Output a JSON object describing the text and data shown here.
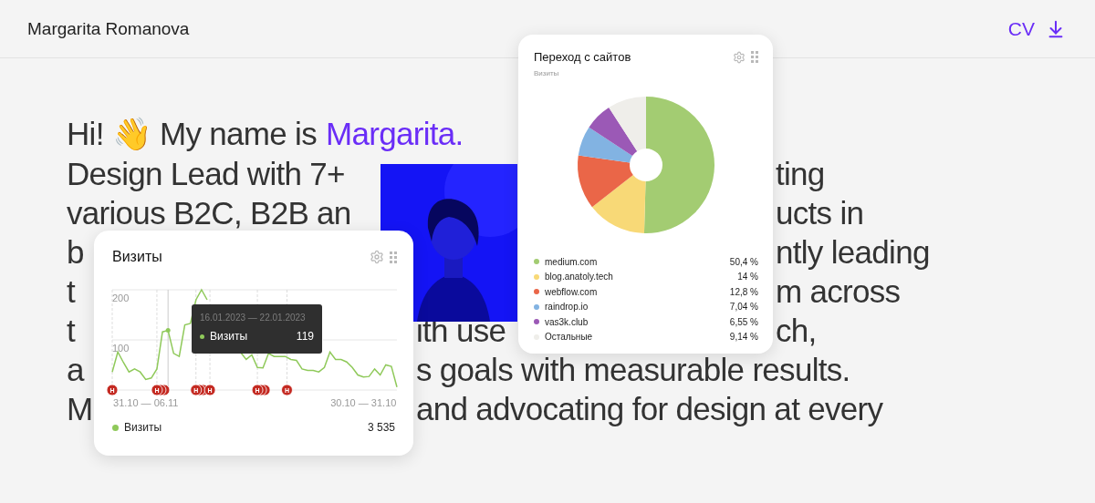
{
  "header": {
    "name": "Margarita Romanova",
    "cv_label": "CV"
  },
  "hero": {
    "lines": [
      {
        "segments": [
          {
            "text": "Hi! 👋 My name is",
            "kind": "left",
            "accent": false
          },
          {
            "text": "Margarita.",
            "kind": "left",
            "accent": true
          }
        ]
      },
      {
        "segments": [
          {
            "text": "Design Lead with 7+",
            "kind": "left",
            "accent": false
          },
          {
            "text": "ting",
            "kind": "right",
            "accent": false
          }
        ]
      },
      {
        "segments": [
          {
            "text": "various B2C, B2B an",
            "kind": "left",
            "accent": false
          },
          {
            "text": "ucts in",
            "kind": "right",
            "accent": false
          }
        ]
      },
      {
        "segments": [
          {
            "text": "b",
            "kind": "left",
            "accent": false
          },
          {
            "text": "ntly leading",
            "kind": "right",
            "accent": false
          }
        ]
      },
      {
        "segments": [
          {
            "text": "t",
            "kind": "left",
            "accent": false
          },
          {
            "text": "m across",
            "kind": "right",
            "accent": false
          }
        ]
      },
      {
        "segments": [
          {
            "text": "t",
            "kind": "left",
            "accent": false
          },
          {
            "text": "ith use",
            "kind": "middle",
            "accent": false
          },
          {
            "text": "ch,",
            "kind": "right",
            "accent": false
          }
        ]
      },
      {
        "segments": [
          {
            "text": "a",
            "kind": "left",
            "accent": false
          },
          {
            "text": "s goals with measurable results.",
            "kind": "middle",
            "accent": false
          }
        ]
      },
      {
        "segments": [
          {
            "text": "M",
            "kind": "left",
            "accent": false
          },
          {
            "text": "and advocating for design at every",
            "kind": "middle",
            "accent": false
          }
        ]
      }
    ]
  },
  "sources_card": {
    "title": "Переход с сайтов",
    "subtitle": "Визиты",
    "chart_data": {
      "type": "donut",
      "categories": [
        "medium.com",
        "blog.anatoly.tech",
        "webflow.com",
        "raindrop.io",
        "vas3k.club",
        "Остальные"
      ],
      "values": [
        50.4,
        14,
        12.8,
        7.04,
        6.55,
        9.14
      ]
    },
    "legend": [
      {
        "value": "50,4 %",
        "color": "#a3cc72"
      },
      {
        "value": "14 %",
        "color": "#f8d977"
      },
      {
        "value": "12,8 %",
        "color": "#ea6648"
      },
      {
        "value": "7,04 %",
        "color": "#82b3e2"
      },
      {
        "value": "6,55 %",
        "color": "#9b59b6"
      },
      {
        "value": "9,14 %",
        "color": "#efeeea"
      }
    ]
  },
  "visits_card": {
    "title": "Визиты",
    "chart_data": {
      "type": "line",
      "ylim": [
        0,
        200
      ],
      "yticks": [
        100,
        200
      ],
      "grid": true,
      "categories": [
        null,
        null,
        null,
        null,
        null,
        null,
        "31.10 — 06.11",
        null,
        null,
        null,
        null,
        null,
        null,
        null,
        null,
        null,
        null,
        null,
        null,
        null,
        null,
        null,
        null,
        null,
        null,
        null,
        null,
        null,
        null,
        null,
        null,
        null,
        null,
        null,
        null,
        null,
        null,
        null,
        null,
        null,
        null,
        null,
        null,
        null,
        null,
        "30.10 — 31.10",
        null,
        null,
        null,
        null,
        null,
        null
      ],
      "series": [
        {
          "name": "Визиты",
          "color": "#8fc95a",
          "values": [
            36,
            76,
            55,
            36,
            42,
            36,
            21,
            24,
            42,
            116,
            119,
            73,
            67,
            130,
            133,
            180,
            200,
            180,
            null,
            null,
            null,
            null,
            null,
            75,
            61,
            70,
            45,
            44,
            73,
            67,
            67,
            67,
            61,
            59,
            42,
            39,
            39,
            36,
            45,
            76,
            61,
            61,
            56,
            45,
            30,
            26,
            27,
            42,
            30,
            50,
            47,
            6
          ]
        }
      ]
    },
    "event_markers": [
      {
        "label": "Н",
        "kind": "single"
      },
      {
        "label": "Н",
        "kind": "stack"
      },
      {
        "label": "Н",
        "kind": "stack"
      },
      {
        "label": "Н",
        "kind": "single"
      },
      {
        "label": "Н",
        "kind": "stack"
      },
      {
        "label": "Н",
        "kind": "single"
      }
    ],
    "tooltip": {
      "period": "16.01.2023 — 22.01.2023",
      "value": "119"
    },
    "legend": {
      "name": "Визиты",
      "total": "3 535"
    }
  }
}
